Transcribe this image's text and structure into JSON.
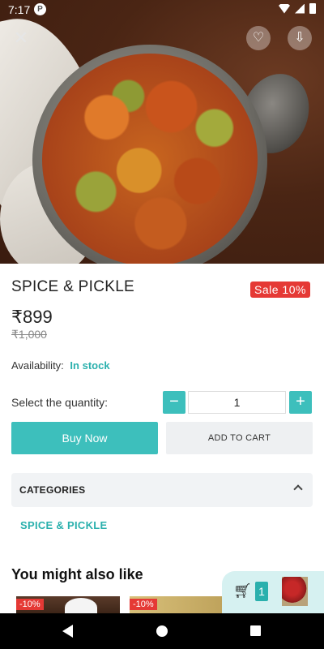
{
  "status": {
    "time": "7:17",
    "app_badge": "P"
  },
  "product": {
    "title": "SPICE & PICKLE",
    "sale_badge": "Sale 10%",
    "price": "₹899",
    "old_price": "₹1,000",
    "availability_label": "Availability:",
    "availability_value": "In stock"
  },
  "quantity": {
    "label": "Select the quantity:",
    "value": "1",
    "minus": "−",
    "plus": "+"
  },
  "actions": {
    "buy_now": "Buy Now",
    "add_to_cart": "ADD TO CART"
  },
  "categories": {
    "title": "CATEGORIES",
    "items": [
      "SPICE & PICKLE"
    ]
  },
  "recommendations": {
    "heading": "You might also like",
    "items": [
      {
        "badge": "-10%"
      },
      {
        "badge": "-10%"
      }
    ]
  },
  "cart": {
    "count": "1"
  },
  "colors": {
    "accent": "#3dbfbc",
    "sale": "#e53935"
  }
}
